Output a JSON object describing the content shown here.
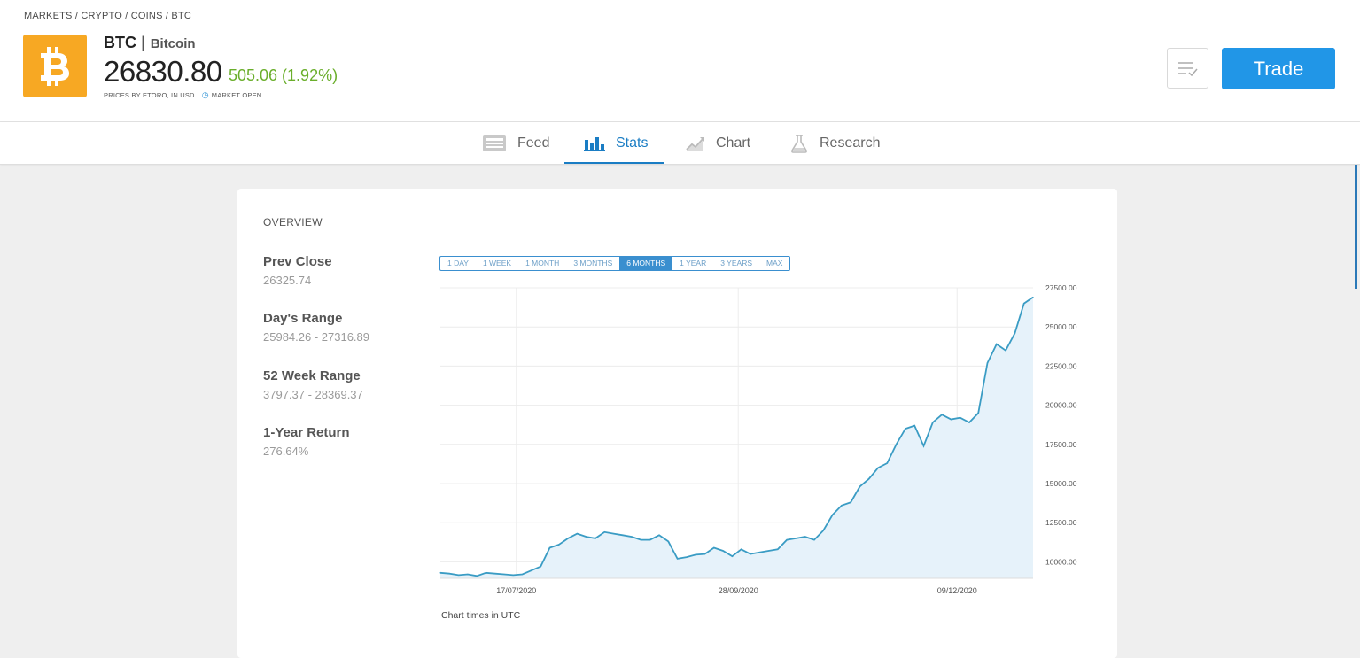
{
  "breadcrumb": [
    "MARKETS",
    "CRYPTO",
    "COINS",
    "BTC"
  ],
  "asset": {
    "ticker": "BTC",
    "separator": "|",
    "name": "Bitcoin",
    "price": "26830.80",
    "change": "505.06 (1.92%)",
    "source_note": "PRICES BY ETORO, IN USD",
    "market_status": "MARKET OPEN",
    "logo_icon": "bitcoin-logo-icon",
    "change_color": "#6aae2b",
    "logo_color": "#f7a823"
  },
  "actions": {
    "watchlist_icon": "watchlist-icon",
    "trade_label": "Trade",
    "trade_color": "#2196e7"
  },
  "tabs": [
    {
      "label": "Feed",
      "icon": "feed-icon",
      "active": false
    },
    {
      "label": "Stats",
      "icon": "stats-icon",
      "active": true
    },
    {
      "label": "Chart",
      "icon": "chart-icon",
      "active": false
    },
    {
      "label": "Research",
      "icon": "research-flask-icon",
      "active": false
    }
  ],
  "overview": {
    "title": "OVERVIEW",
    "stats": [
      {
        "label": "Prev Close",
        "value": "26325.74"
      },
      {
        "label": "Day's Range",
        "value": "25984.26 - 27316.89"
      },
      {
        "label": "52 Week Range",
        "value": "3797.37 - 28369.37"
      },
      {
        "label": "1-Year Return",
        "value": "276.64%"
      }
    ]
  },
  "ranges": {
    "options": [
      "1 DAY",
      "1 WEEK",
      "1 MONTH",
      "3 MONTHS",
      "6 MONTHS",
      "1 YEAR",
      "3 YEARS",
      "MAX"
    ],
    "selected": "6 MONTHS"
  },
  "chart_note": "Chart times in UTC",
  "chart_data": {
    "type": "area",
    "x_tick_labels": [
      "17/07/2020",
      "28/09/2020",
      "09/12/2020"
    ],
    "y_tick_labels": [
      "27500.00",
      "25000.00",
      "22500.00",
      "20000.00",
      "17500.00",
      "15000.00",
      "12500.00",
      "10000.00"
    ],
    "y_ticks": [
      27500,
      25000,
      22500,
      20000,
      17500,
      15000,
      12500,
      10000
    ],
    "ylim": [
      9000,
      27500
    ],
    "line_color": "#3a9cc4",
    "fill_color": "#e6f2fa",
    "grid": true,
    "x": [
      "2020-06-22",
      "2020-06-25",
      "2020-06-28",
      "2020-07-01",
      "2020-07-04",
      "2020-07-07",
      "2020-07-10",
      "2020-07-13",
      "2020-07-16",
      "2020-07-19",
      "2020-07-22",
      "2020-07-25",
      "2020-07-28",
      "2020-07-31",
      "2020-08-03",
      "2020-08-06",
      "2020-08-09",
      "2020-08-12",
      "2020-08-15",
      "2020-08-18",
      "2020-08-21",
      "2020-08-24",
      "2020-08-27",
      "2020-08-30",
      "2020-09-02",
      "2020-09-05",
      "2020-09-08",
      "2020-09-11",
      "2020-09-14",
      "2020-09-17",
      "2020-09-20",
      "2020-09-23",
      "2020-09-26",
      "2020-09-29",
      "2020-10-02",
      "2020-10-05",
      "2020-10-08",
      "2020-10-11",
      "2020-10-14",
      "2020-10-17",
      "2020-10-20",
      "2020-10-23",
      "2020-10-26",
      "2020-10-29",
      "2020-11-01",
      "2020-11-04",
      "2020-11-07",
      "2020-11-10",
      "2020-11-13",
      "2020-11-16",
      "2020-11-19",
      "2020-11-22",
      "2020-11-25",
      "2020-11-28",
      "2020-12-01",
      "2020-12-04",
      "2020-12-07",
      "2020-12-10",
      "2020-12-13",
      "2020-12-16",
      "2020-12-19",
      "2020-12-22",
      "2020-12-25",
      "2020-12-28",
      "2020-12-31",
      "2021-01-03"
    ],
    "values": [
      9300,
      9250,
      9150,
      9200,
      9100,
      9300,
      9250,
      9200,
      9150,
      9200,
      9450,
      9700,
      10900,
      11100,
      11500,
      11800,
      11600,
      11500,
      11900,
      11800,
      11700,
      11600,
      11400,
      11400,
      11700,
      11300,
      10200,
      10300,
      10450,
      10500,
      10900,
      10700,
      10350,
      10800,
      10500,
      10600,
      10700,
      10800,
      11400,
      11500,
      11600,
      11400,
      12000,
      13000,
      13600,
      13800,
      14800,
      15300,
      16000,
      16300,
      17500,
      18500,
      18700,
      17400,
      18900,
      19400,
      19100,
      19200,
      18900,
      19500,
      22700,
      23900,
      23500,
      24600,
      26500,
      26900
    ]
  }
}
